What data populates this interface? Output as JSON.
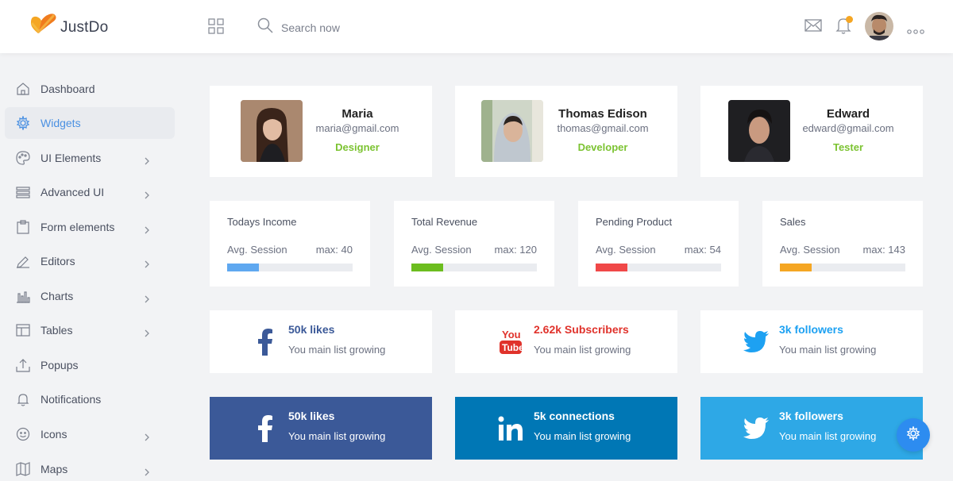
{
  "header": {
    "logo_text": "JustDo",
    "search_placeholder": "Search now"
  },
  "sidebar": {
    "items": [
      {
        "label": "Dashboard"
      },
      {
        "label": "Widgets"
      },
      {
        "label": "UI Elements"
      },
      {
        "label": "Advanced UI"
      },
      {
        "label": "Form elements"
      },
      {
        "label": "Editors"
      },
      {
        "label": "Charts"
      },
      {
        "label": "Tables"
      },
      {
        "label": "Popups"
      },
      {
        "label": "Notifications"
      },
      {
        "label": "Icons"
      },
      {
        "label": "Maps"
      }
    ]
  },
  "profiles": [
    {
      "name": "Maria",
      "email": "maria@gmail.com",
      "role": "Designer"
    },
    {
      "name": "Thomas Edison",
      "email": "thomas@gmail.com",
      "role": "Developer"
    },
    {
      "name": "Edward",
      "email": "edward@gmail.com",
      "role": "Tester"
    }
  ],
  "stats": [
    {
      "title": "Todays Income",
      "avg": "Avg. Session",
      "max": "max: 40",
      "progress": 0.25,
      "color": "#5fa8f0"
    },
    {
      "title": "Total Revenue",
      "avg": "Avg. Session",
      "max": "max: 120",
      "progress": 0.25,
      "color": "#6cbd1f"
    },
    {
      "title": "Pending Product",
      "avg": "Avg. Session",
      "max": "max: 54",
      "progress": 0.25,
      "color": "#f04848"
    },
    {
      "title": "Sales",
      "avg": "Avg. Session",
      "max": "max: 143",
      "progress": 0.25,
      "color": "#f5a623"
    }
  ],
  "social_outline": [
    {
      "title": "50k likes",
      "sub": "You main list growing",
      "icon": "facebook-icon",
      "color": "#3b5998"
    },
    {
      "title": "2.62k Subscribers",
      "sub": "You main list growing",
      "icon": "youtube-icon",
      "color": "#e0322b"
    },
    {
      "title": "3k followers",
      "sub": "You main list growing",
      "icon": "twitter-icon",
      "color": "#1da1f2"
    }
  ],
  "social_filled": [
    {
      "title": "50k likes",
      "sub": "You main list growing",
      "icon": "facebook-icon",
      "color": "#3b5998"
    },
    {
      "title": "5k connections",
      "sub": "You main list growing",
      "icon": "linkedin-icon",
      "color": "#0077b5"
    },
    {
      "title": "3k followers",
      "sub": "You main list growing",
      "icon": "twitter-icon",
      "color": "#2ea8e6"
    }
  ]
}
